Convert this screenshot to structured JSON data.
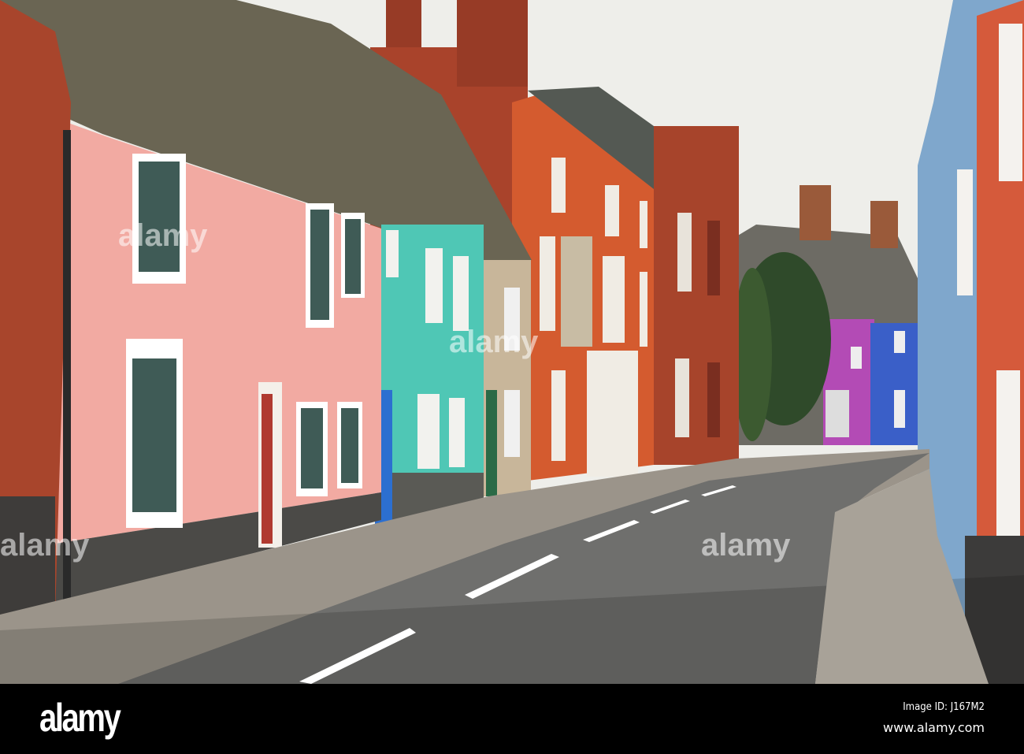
{
  "photo": {
    "description_icon": "street-photo",
    "watermark_text": "alamy"
  },
  "footer": {
    "logo": "alamy",
    "image_id": "Image ID: J167M2",
    "url": "www.alamy.com"
  }
}
